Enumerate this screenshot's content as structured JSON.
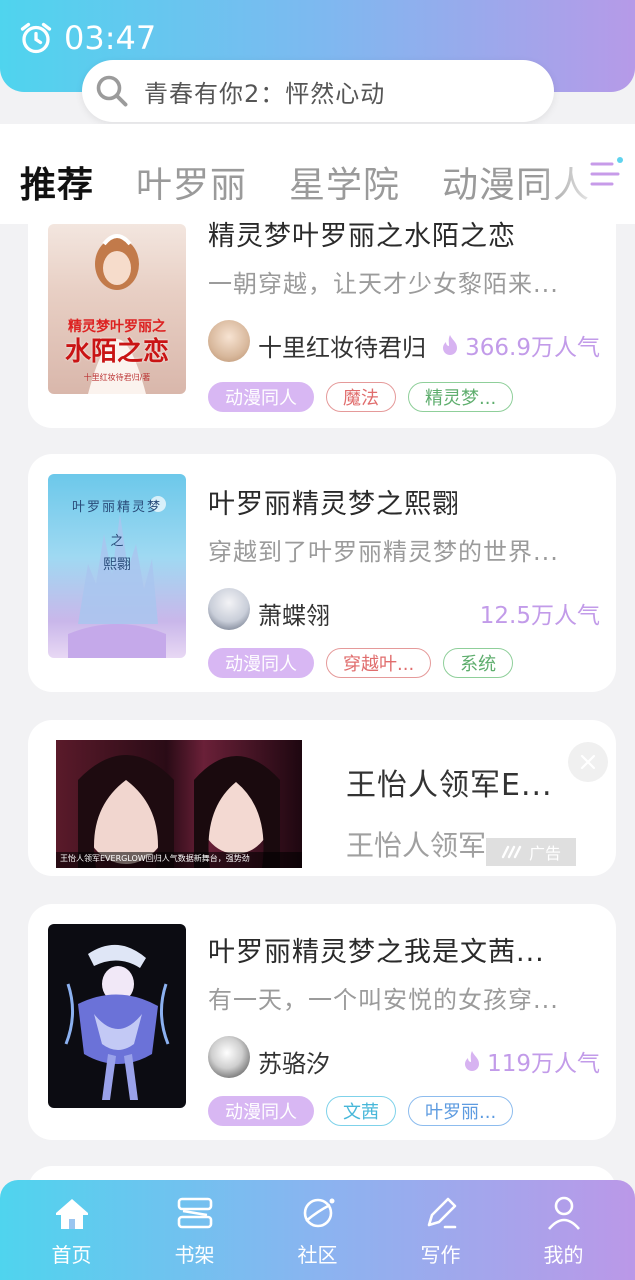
{
  "status": {
    "time": "03:47"
  },
  "search": {
    "placeholder": "青春有你2：怦然心动"
  },
  "tabs": [
    {
      "label": "推荐",
      "active": true
    },
    {
      "label": "叶罗丽"
    },
    {
      "label": "星学院"
    },
    {
      "label": "动漫同人"
    }
  ],
  "books": [
    {
      "title": "精灵梦叶罗丽之水陌之恋",
      "desc": "一朝穿越，让天才少女黎陌来...",
      "author": "十里红妆待君归",
      "popularity": "366.9万人气",
      "cover_text": [
        "精灵梦叶罗丽之",
        "水陌之恋",
        "十里红妆待君归/著"
      ],
      "tags": [
        {
          "label": "动漫同人",
          "style": "fill"
        },
        {
          "label": "魔法",
          "style": "red"
        },
        {
          "label": "精灵梦...",
          "style": "green"
        }
      ]
    },
    {
      "title": "叶罗丽精灵梦之熙翾",
      "desc": "穿越到了叶罗丽精灵梦的世界...",
      "author": "萧蝶翎",
      "popularity": "12.5万人气",
      "cover_text": [
        "叶罗丽精灵梦",
        "之",
        "熙翾"
      ],
      "tags": [
        {
          "label": "动漫同人",
          "style": "fill"
        },
        {
          "label": "穿越叶...",
          "style": "red"
        },
        {
          "label": "系统",
          "style": "green"
        }
      ]
    },
    {
      "title": "叶罗丽精灵梦之我是文茜...",
      "desc": "有一天，一个叫安悦的女孩穿...",
      "author": "苏骆汐",
      "popularity": "119万人气",
      "tags": [
        {
          "label": "动漫同人",
          "style": "fill"
        },
        {
          "label": "文茜",
          "style": "cyan"
        },
        {
          "label": "叶罗丽...",
          "style": "blue"
        }
      ]
    }
  ],
  "ad": {
    "title": "王怡人领军E...",
    "subtitle": "王怡人领军",
    "badge": "广告",
    "caption": "王怡人领军EVERGLOW回归人气数据新舞台，强势劲"
  },
  "nav": [
    {
      "label": "首页",
      "icon": "home-icon"
    },
    {
      "label": "书架",
      "icon": "bookshelf-icon"
    },
    {
      "label": "社区",
      "icon": "planet-icon"
    },
    {
      "label": "写作",
      "icon": "pen-icon"
    },
    {
      "label": "我的",
      "icon": "user-icon"
    }
  ],
  "colors": {
    "accent": "#b79ae9",
    "popularity": "#c29be9",
    "gradient_start": "#4fd4ee",
    "gradient_end": "#b69ae8"
  }
}
